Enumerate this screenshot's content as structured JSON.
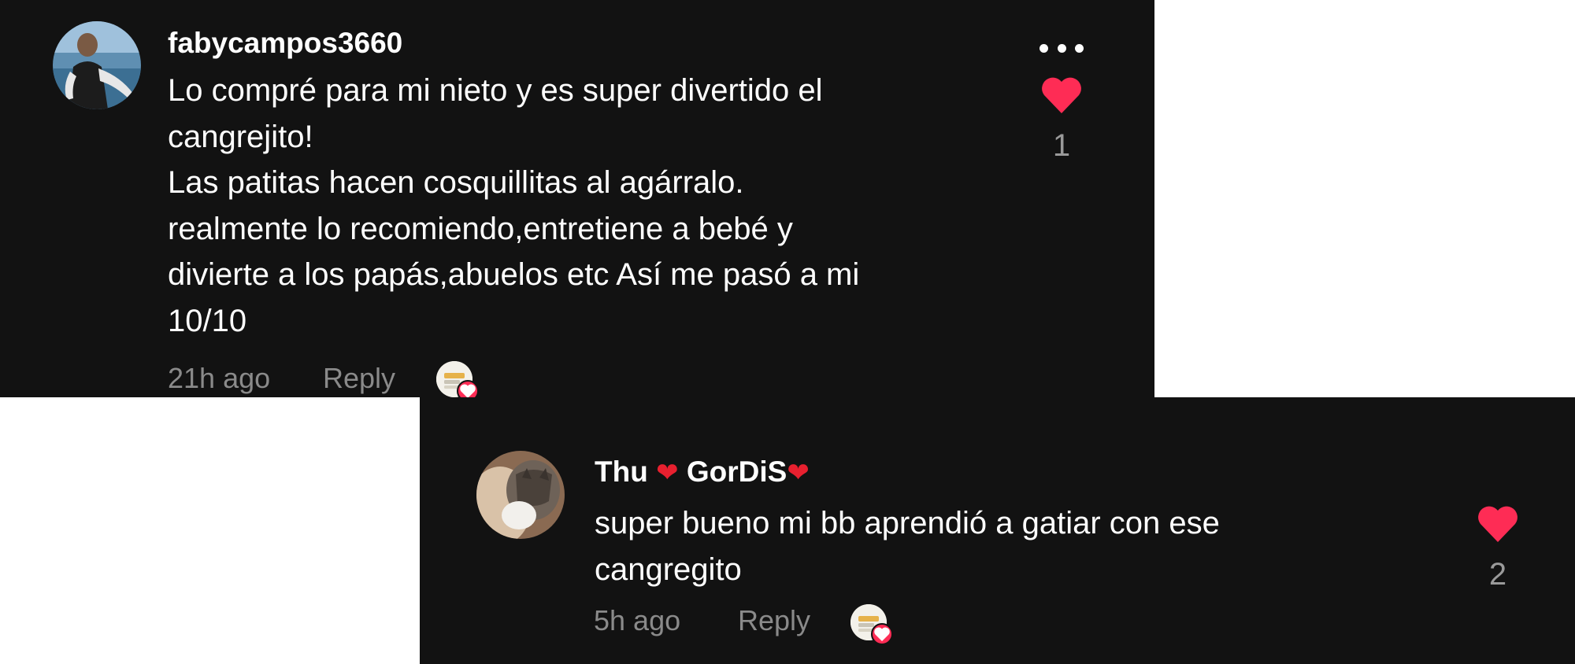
{
  "comments": [
    {
      "username": "fabycampos3660",
      "text_lines": [
        "Lo compré para mi nieto y es super divertido el",
        "cangrejito!",
        "Las patitas hacen cosquillitas al agárralo.",
        "realmente lo recomiendo,entretiene a bebé y",
        "divierte a los papás,abuelos etc Así me pasó a mi",
        "10/10"
      ],
      "time": "21h ago",
      "reply_label": "Reply",
      "likes": "1"
    },
    {
      "username_part1": "Thu",
      "username_heart": "❤",
      "username_part2": "GorDiS",
      "text_lines": [
        "super bueno mi bb aprendió a gatiar con ese",
        "cangregito"
      ],
      "time": "5h ago",
      "reply_label": "Reply",
      "likes": "2"
    }
  ],
  "colors": {
    "background": "#121212",
    "like_heart": "#fe2c55",
    "meta_text": "#8a8a8a"
  },
  "icons": {
    "more": "more-options-icon",
    "like": "heart-icon",
    "creator_liked": "creator-liked-icon"
  }
}
